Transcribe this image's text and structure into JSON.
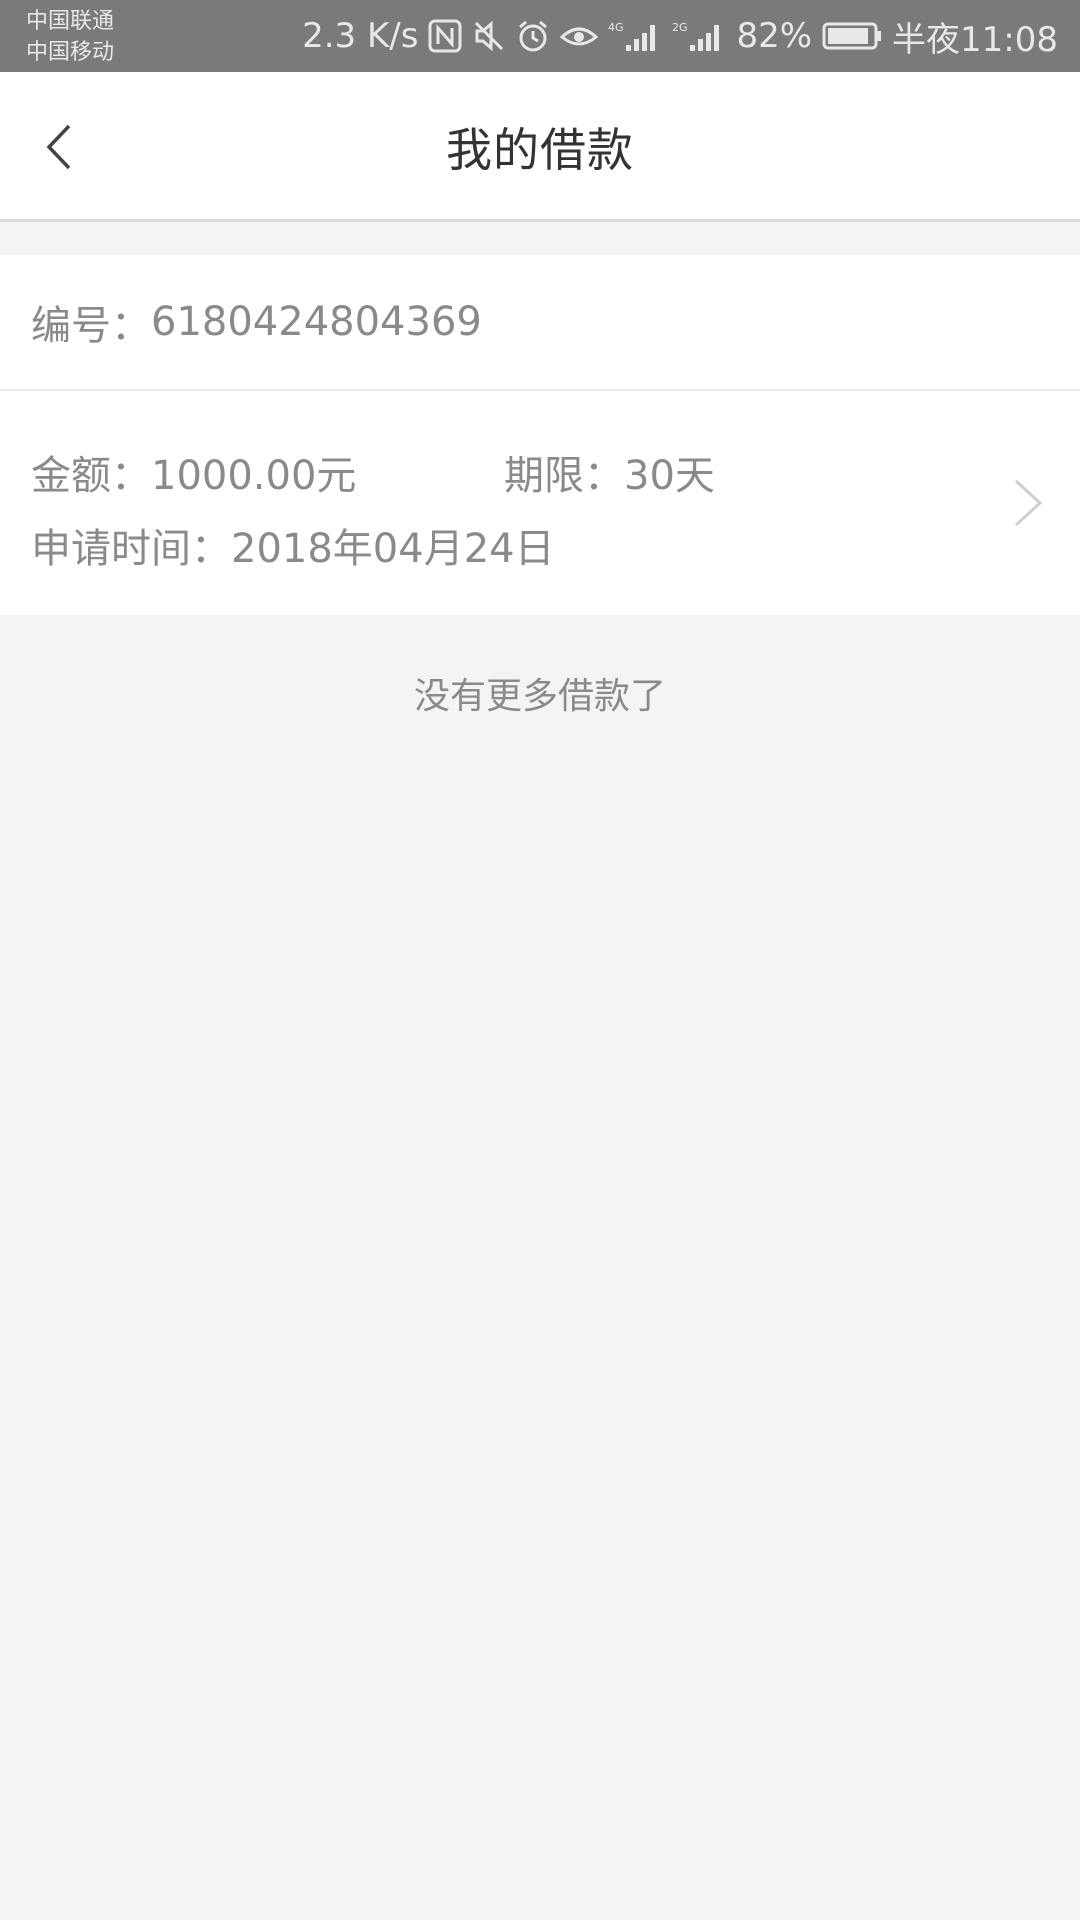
{
  "status_bar": {
    "carrier_1": "中国联通",
    "carrier_2": "中国移动",
    "network_speed": "2.3 K/s",
    "battery_percent": "82%",
    "time": "半夜11:08",
    "icons": [
      "nfc-icon",
      "mute-icon",
      "alarm-icon",
      "eye-icon",
      "signal-4g-icon",
      "signal-2g-icon",
      "battery-icon"
    ],
    "color": "#7a7a7a"
  },
  "header": {
    "title": "我的借款"
  },
  "loan": {
    "number_label": "编号：",
    "number_value": "6180424804369",
    "amount_label": "金额：",
    "amount_value": "1000.00元",
    "term_label": "期限：",
    "term_value": "30天",
    "date_label": "申请时间：",
    "date_value": "2018年04月24日"
  },
  "footer_text": "没有更多借款了",
  "colors": {
    "background": "#f4f4f4",
    "card": "#ffffff",
    "text_secondary": "#8a8a8a",
    "title": "#333333"
  }
}
